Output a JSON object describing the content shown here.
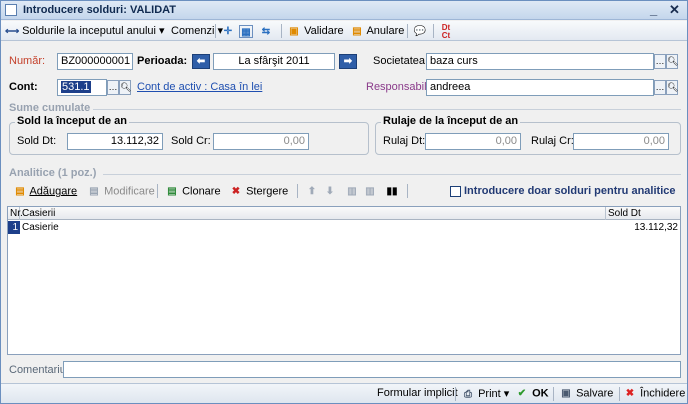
{
  "window": {
    "title": "Introducere solduri: VALIDAT",
    "minimize": "_",
    "close": "✕"
  },
  "toolbar": {
    "sold_initial": "Soldurile la inceputul anului",
    "comenzi": "Comenzi",
    "validare": "Validare",
    "anulare": "Anulare"
  },
  "header": {
    "numar_label": "Număr:",
    "numar_value": "BZ000000001",
    "perioada_label": "Perioada:",
    "perioada_value": "La sfârşit 2011",
    "societatea_label": "Societatea:",
    "societatea_value": "baza curs",
    "cont_label": "Cont:",
    "cont_value": "531.1",
    "cont_link": "Cont de activ : Casa în lei",
    "responsabil_label": "Responsabil:",
    "responsabil_value": "andreea"
  },
  "sume": {
    "section_title": "Sume cumulate",
    "sold_group": "Sold la început de an",
    "sold_dt_label": "Sold Dt:",
    "sold_dt_value": "13.112,32",
    "sold_cr_label": "Sold Cr:",
    "sold_cr_value": "0,00",
    "rulaje_group": "Rulaje de la început de an",
    "rulaj_dt_label": "Rulaj Dt:",
    "rulaj_dt_value": "0,00",
    "rulaj_cr_label": "Rulaj Cr:",
    "rulaj_cr_value": "0,00"
  },
  "analitice": {
    "section_title": "Analitice (1 poz.)",
    "adaugare": "Adăugare",
    "modificare": "Modificare",
    "clonare": "Clonare",
    "stergere": "Stergere",
    "doar_solduri": "Introducere doar solduri pentru analitice"
  },
  "table": {
    "columns": [
      "Nr.",
      "Casierii",
      "Sold Dt"
    ],
    "rows": [
      {
        "nr": "1",
        "casierii": "Casierie",
        "sold_dt": "13.112,32"
      }
    ]
  },
  "comentariu_label": "Comentariu:",
  "status": {
    "formular": "Formular implicit",
    "print": "Print",
    "ok": "OK",
    "salvare": "Salvare",
    "inchidere": "Închidere"
  }
}
